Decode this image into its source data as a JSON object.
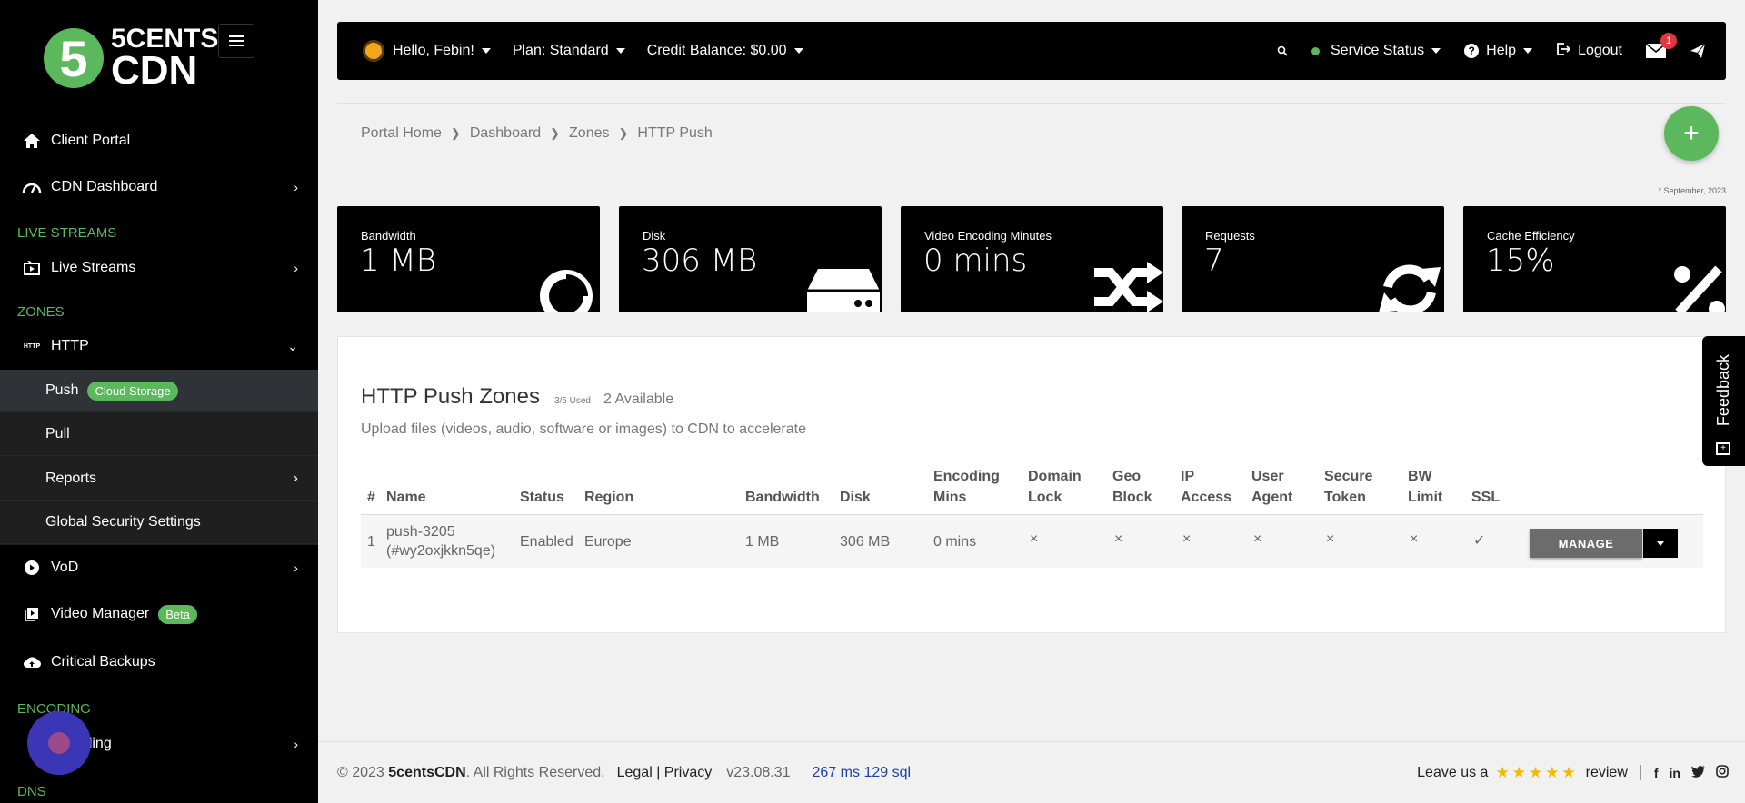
{
  "sidebar": {
    "logo": {
      "top": "5CENTS",
      "bottom": "CDN",
      "mark": "5"
    },
    "items": {
      "client_portal": "Client Portal",
      "cdn_dashboard": "CDN Dashboard",
      "live_streams_head": "LIVE STREAMS",
      "live_streams": "Live Streams",
      "zones_head": "ZONES",
      "http": "HTTP",
      "push": "Push",
      "push_badge": "Cloud Storage",
      "pull": "Pull",
      "reports": "Reports",
      "global_security": "Global Security Settings",
      "vod": "VoD",
      "video_manager": "Video Manager",
      "video_manager_badge": "Beta",
      "critical_backups": "Critical Backups",
      "encoding_head": "ENCODING",
      "encoding": "Encoding",
      "dns_head": "DNS"
    }
  },
  "topbar": {
    "greeting": "Hello, Febin!",
    "plan": "Plan: Standard",
    "credit": "Credit Balance: $0.00",
    "service_status": "Service Status",
    "help": "Help",
    "logout": "Logout",
    "mail_count": "1"
  },
  "breadcrumb": [
    "Portal Home",
    "Dashboard",
    "Zones",
    "HTTP Push"
  ],
  "date_note": "* September, 2023",
  "cards": [
    {
      "label": "Bandwidth",
      "value": "1 MB",
      "icon": "chart-pie-icon"
    },
    {
      "label": "Disk",
      "value": "306 MB",
      "icon": "hard-drive-icon"
    },
    {
      "label": "Video Encoding Minutes",
      "value": "0 mins",
      "icon": "shuffle-icon"
    },
    {
      "label": "Requests",
      "value": "7",
      "icon": "sync-icon"
    },
    {
      "label": "Cache Efficiency",
      "value": "15%",
      "icon": "percent-icon"
    }
  ],
  "panel": {
    "title": "HTTP Push Zones",
    "used": "3/5 Used",
    "available": "2 Available",
    "subtitle": "Upload files (videos, audio, software or images) to CDN to accelerate",
    "columns": {
      "num": "#",
      "name": "Name",
      "status": "Status",
      "region": "Region",
      "bandwidth": "Bandwidth",
      "disk": "Disk",
      "enc1": "Encoding",
      "enc2": "Mins",
      "dl1": "Domain",
      "dl2": "Lock",
      "gb1": "Geo",
      "gb2": "Block",
      "ip1": "IP",
      "ip2": "Access",
      "ua1": "User",
      "ua2": "Agent",
      "st1": "Secure",
      "st2": "Token",
      "bw1": "BW",
      "bw2": "Limit",
      "ssl": "SSL"
    },
    "row": {
      "num": "1",
      "name1": "push-3205",
      "name2": "(#wy2oxjkkn5qe)",
      "status": "Enabled",
      "region": "Europe",
      "bandwidth": "1 MB",
      "disk": "306 MB",
      "enc": "0 mins",
      "x": "×",
      "check": "✓",
      "manage": "MANAGE"
    }
  },
  "feedback": "Feedback",
  "footer": {
    "copy_prefix": "© 2023 ",
    "brand": "5centsCDN",
    "copy_suffix": ". All Rights Reserved.",
    "legal": "Legal",
    "privacy": "Privacy",
    "version": "v23.08.31",
    "perf": "267 ms 129 sql",
    "leave": "Leave us a",
    "stars": "★★★★★",
    "review": "review"
  }
}
